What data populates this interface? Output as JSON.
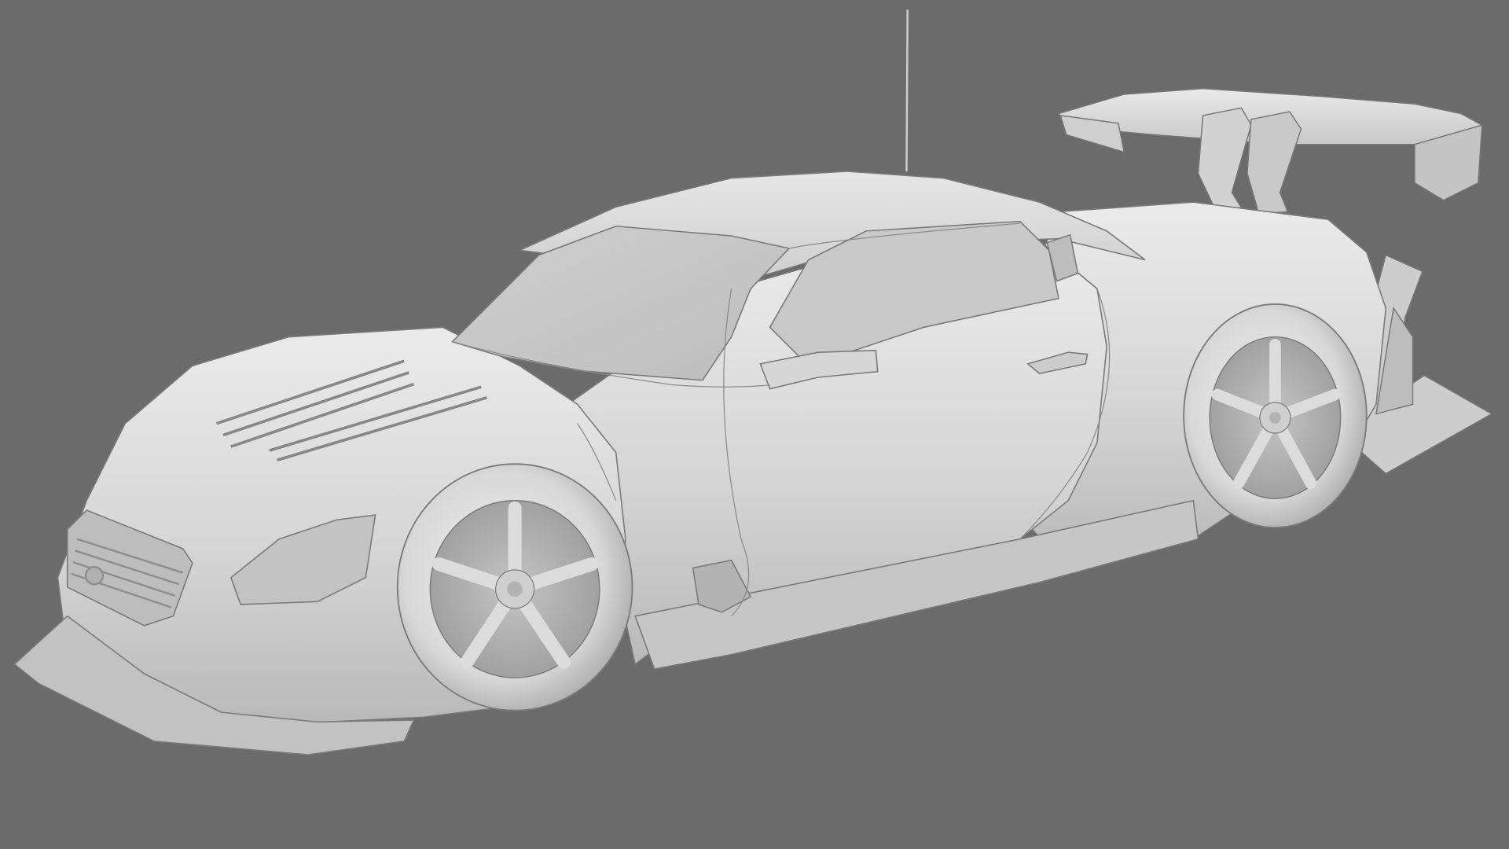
{
  "scene": {
    "background_color": "#6b6b6b",
    "model_color": "#d9d9d9",
    "subject": "clay-render-race-car"
  }
}
